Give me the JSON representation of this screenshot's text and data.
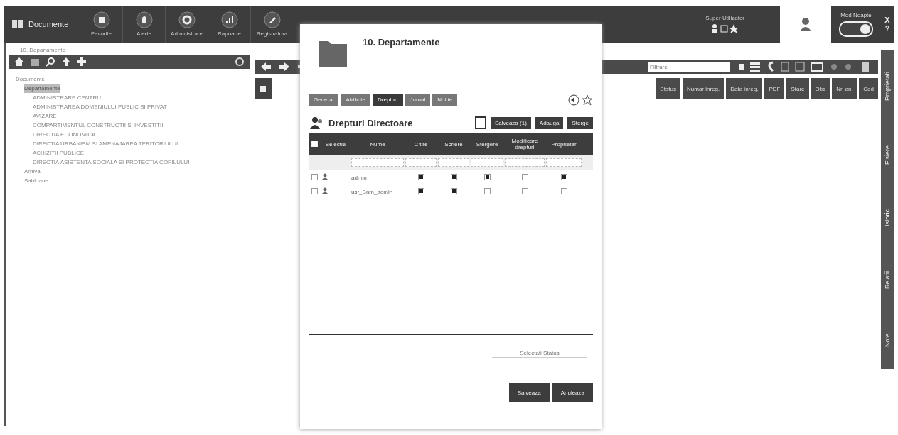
{
  "app": {
    "title": "Documente"
  },
  "nav": [
    {
      "label": "Favorite"
    },
    {
      "label": "Alerte"
    },
    {
      "label": "Administrare"
    },
    {
      "label": "Rapoarte"
    },
    {
      "label": "Registratura"
    }
  ],
  "user": {
    "name": "Super Utilizator"
  },
  "night_mode": {
    "label": "Mod Noapte",
    "on": true
  },
  "window_buttons": [
    "X",
    "?"
  ],
  "breadcrumb": "10. Departamente",
  "tree": [
    {
      "label": "Documente",
      "children": [
        {
          "label": "Departamente",
          "selected": true,
          "children": [
            {
              "label": "ADMINISTRARE CENTRU"
            },
            {
              "label": "ADMINISTRAREA DOMENIULUI PUBLIC SI PRIVAT"
            },
            {
              "label": "AVIZARE"
            },
            {
              "label": "COMPARTIMENTUL CONSTRUCTII SI INVESTITII"
            },
            {
              "label": "DIRECTIA ECONOMICA"
            },
            {
              "label": "DIRECTIA URBANISM SI AMENAJAREA TERITORIULUI"
            },
            {
              "label": "ACHIZITII PUBLICE"
            },
            {
              "label": "DIRECTIA ASISTENTA SOCIALA SI PROTECTIA COPILULUI"
            }
          ]
        },
        {
          "label": "Arhiva"
        },
        {
          "label": "Sabloane"
        }
      ]
    }
  ],
  "search": {
    "placeholder": "Filtrare"
  },
  "columns": [
    "Status",
    "Numar inreg.",
    "Data inreg.",
    "PDF",
    "Stare",
    "Obs",
    "Nr. ani",
    "Cod"
  ],
  "side_tabs": [
    "Proprietati",
    "Fisiere",
    "Istoric",
    "Relatii",
    "Note"
  ],
  "dialog": {
    "title": "10. Departamente",
    "tabs": [
      {
        "label": "General",
        "selected": false
      },
      {
        "label": "Atribute",
        "selected": false
      },
      {
        "label": "Drepturi",
        "selected": true
      },
      {
        "label": "Jurnal",
        "selected": false
      },
      {
        "label": "Notite",
        "selected": false
      }
    ],
    "section": "Drepturi Directoare",
    "actions": [
      "Salveaza (1)",
      "Adauga",
      "Sterge"
    ],
    "all_selected": false,
    "columns": [
      "Selectie",
      "Nume",
      "Citire",
      "Scriere",
      "Stergere",
      "Modificare drepturi",
      "Proprietar"
    ],
    "rows": [
      {
        "name": "admin",
        "selected": false,
        "rights": [
          true,
          true,
          true,
          false,
          true
        ]
      },
      {
        "name": "usr_Bnm_admin",
        "selected": false,
        "rights": [
          true,
          true,
          false,
          false,
          false
        ]
      }
    ],
    "status_field": {
      "placeholder": "Selectati Status"
    },
    "buttons": [
      "Salveaza",
      "Anuleaza"
    ]
  }
}
